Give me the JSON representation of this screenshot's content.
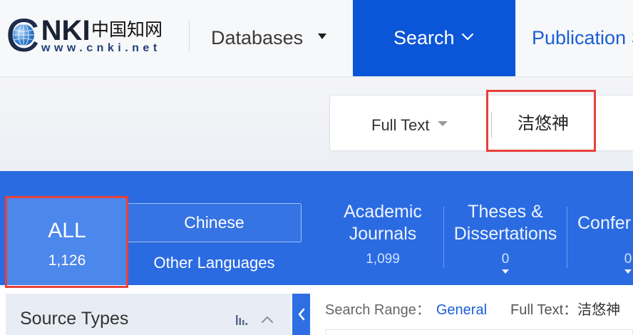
{
  "header": {
    "logo": {
      "mark": "CNKI",
      "name": "中国知网",
      "url": "www.cnki.net"
    },
    "nav": {
      "databases": {
        "label": "Databases",
        "dropdown": true
      },
      "search": {
        "label": "Search",
        "active": true,
        "dropdown": true
      },
      "publication": {
        "label": "Publication S"
      }
    }
  },
  "search": {
    "field": "Full Text",
    "query": "洁悠神"
  },
  "results_tabs": {
    "all": {
      "label": "ALL",
      "count": "1,126",
      "selected": true
    },
    "language": {
      "chinese": "Chinese",
      "other": "Other Languages"
    },
    "types": [
      {
        "lines": [
          "Academic",
          "Journals"
        ],
        "count": "1,099"
      },
      {
        "lines": [
          "Theses &",
          "Dissertations"
        ],
        "count": "0"
      },
      {
        "lines": [
          "Confer"
        ],
        "count": "0"
      }
    ]
  },
  "sidebar": {
    "source_types": {
      "title": "Source Types"
    }
  },
  "search_range": {
    "label": "Search Range：",
    "scope": "General",
    "field_label": "Full Text：",
    "query": "洁悠神"
  },
  "icons": {
    "logo": "globe-icon",
    "databases": "caret-down-icon",
    "search": "chevron-down-icon",
    "field": "caret-down-icon",
    "type_expand": "caret-down-icon",
    "source_chart": "bar-chart-icon",
    "source_toggle": "chevron-up-icon",
    "panel_toggle": "chevron-left-icon"
  },
  "colors": {
    "brand": "#0b55d8",
    "band": "#2a6be2",
    "link": "#1a5fd6",
    "mark": "#e8413a"
  }
}
